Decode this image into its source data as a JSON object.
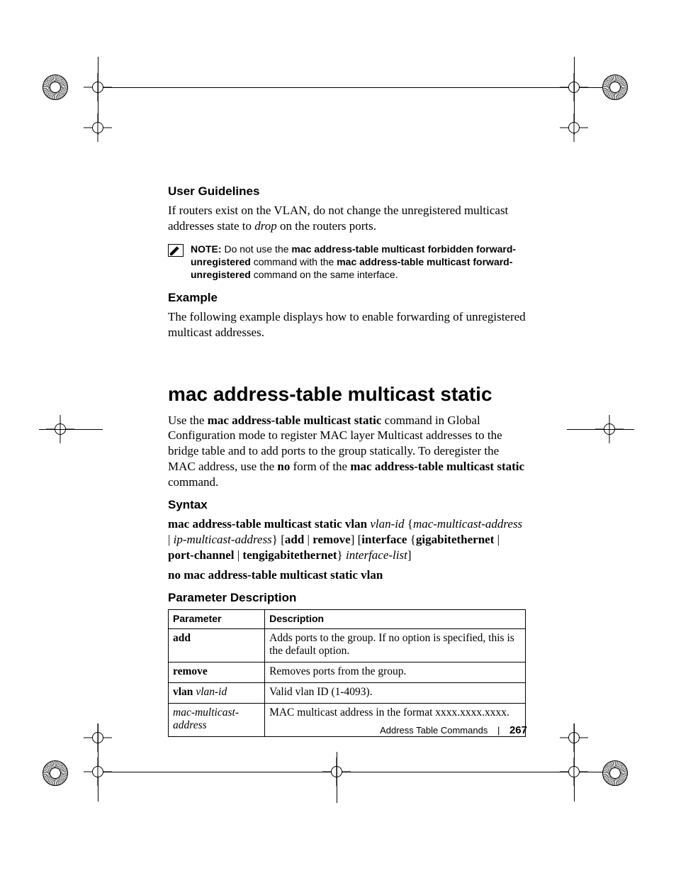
{
  "sections": {
    "user_guidelines": {
      "heading": "User Guidelines",
      "p1_a": "If routers exist on the VLAN, do not change the unregistered multicast addresses state to ",
      "p1_drop": "drop",
      "p1_b": " on the routers ports."
    },
    "note": {
      "label": "NOTE:",
      "t1": " Do not use the ",
      "b1": "mac address-table multicast forbidden forward-unregistered",
      "t2": " command with the ",
      "b2": "mac address-table multicast forward-unregistered",
      "t3": " command on the same interface."
    },
    "example": {
      "heading": "Example",
      "p": "The following example displays how to enable forwarding of unregistered multicast addresses."
    },
    "command": {
      "heading": "mac address-table multicast static",
      "intro_a": "Use the ",
      "intro_b1": "mac address-table multicast static",
      "intro_b": " command in Global Configuration mode to register MAC layer Multicast addresses to the bridge table and to add ports to the group statically. To deregister the MAC address, use the ",
      "intro_b2": "no",
      "intro_c": " form of the ",
      "intro_b3": "mac address-table multicast static",
      "intro_d": " command."
    },
    "syntax": {
      "heading": "Syntax",
      "l1_b1": "mac address-table multicast static vlan ",
      "l1_i1": "vlan-id",
      "l1_t1": " {",
      "l1_i2": "mac-multicast-address",
      "l1_t2": " | ",
      "l1_i3": "ip-multicast-address",
      "l1_t3": "} [",
      "l1_b2": "add",
      "l1_t4": " | ",
      "l1_b3": "remove",
      "l1_t5": "] [",
      "l1_b4": "interface",
      "l1_t6": " {",
      "l1_b5": "gigabitethernet",
      "l1_t7": " | ",
      "l1_b6": "port-channel",
      "l1_t8": " | ",
      "l1_b7": "tengigabitethernet",
      "l1_t9": "} ",
      "l1_i4": "interface-list",
      "l1_t10": "]",
      "l2": "no mac address-table multicast static vlan"
    },
    "param_desc": {
      "heading": "Parameter Description",
      "headers": {
        "p": "Parameter",
        "d": "Description"
      },
      "rows": [
        {
          "p_b": "add",
          "p_i": "",
          "d": "Adds ports to the group. If no option is specified, this is the default option."
        },
        {
          "p_b": "remove",
          "p_i": "",
          "d": "Removes ports from the group."
        },
        {
          "p_b": "vlan ",
          "p_i": "vlan-id",
          "d": "Valid vlan ID (1-4093)."
        },
        {
          "p_b": "",
          "p_i": "mac-multicast-address",
          "d": "MAC multicast address in the format xxxx.xxxx.xxxx."
        }
      ]
    }
  },
  "footer": {
    "section": "Address Table Commands",
    "page": "267"
  }
}
